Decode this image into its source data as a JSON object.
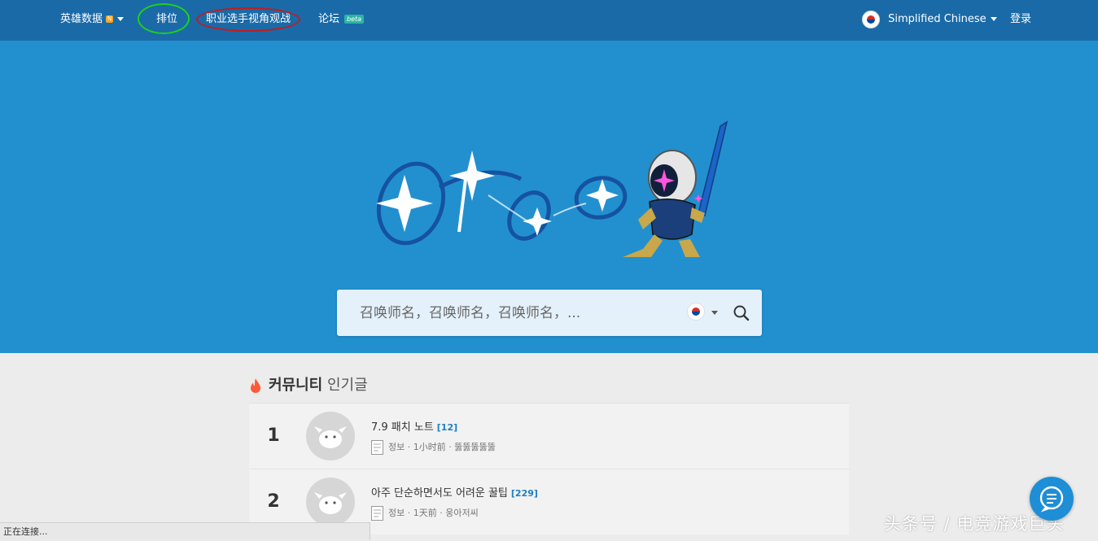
{
  "nav": {
    "champions_label": "英雄数据",
    "new_badge": "N",
    "ranking_label": "排位",
    "pro_spectate_label": "职业选手视角观战",
    "forum_label": "论坛",
    "forum_badge": "beta",
    "language_label": "Simplified Chinese",
    "login_label": "登录"
  },
  "search": {
    "placeholder": "召唤师名，召唤师名，召唤师名，...",
    "region_flag": "korea-flag-icon"
  },
  "community": {
    "title_bold": "커뮤니티",
    "title_light": "인기글",
    "posts": [
      {
        "rank": "1",
        "title": "7.9 패치 노트",
        "comment_count": "[12]",
        "category": "정보",
        "time": "1小时前",
        "author": "뚫뚫뚫뚫뚫"
      },
      {
        "rank": "2",
        "title": "아주 단순하면서도 어려운 꿀팁",
        "comment_count": "[229]",
        "category": "정보",
        "time": "1天前",
        "author": "웅아저씨"
      }
    ]
  },
  "status_bar": {
    "text": "正在连接..."
  },
  "watermark": {
    "text": "头条号 / 电竞游戏巨头"
  },
  "colors": {
    "nav_bg": "#1a6aa8",
    "hero_bg": "#2290cf",
    "page_bg": "#ececec",
    "accent_blue": "#1c7fc4"
  }
}
